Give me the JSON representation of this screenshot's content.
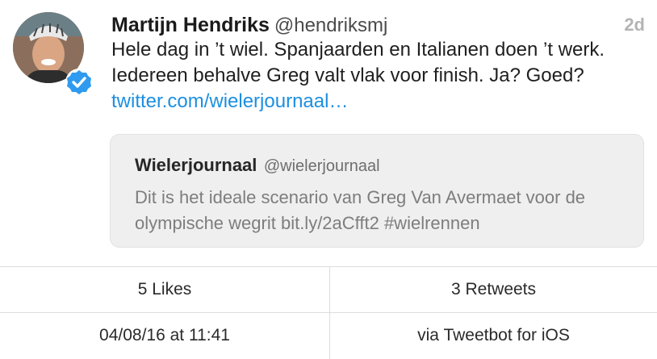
{
  "tweet": {
    "author_name": "Martijn Hendriks",
    "author_handle": "@hendriksmj",
    "time": "2d",
    "text_line": "Hele dag in ’t wiel. Spanjaarden en Italianen doen ’t werk. Iedereen behalve Greg valt vlak voor finish. Ja? Goed?",
    "link": "twitter.com/wielerjournaal…",
    "avatar_icon": "avatar-photo",
    "verified_icon": "verified-badge-icon",
    "verified_color": "#2f9bf0"
  },
  "quoted": {
    "name": "Wielerjournaal",
    "handle": "@wielerjournaal",
    "text": "Dit is het ideale scenario van Greg Van Avermaet voor de olympische wegrit bit.ly/2aCfft2 #wielrennen"
  },
  "stats": {
    "likes": "5 Likes",
    "retweets": "3 Retweets",
    "date": "04/08/16 at 11:41",
    "via": "via Tweetbot for iOS"
  }
}
